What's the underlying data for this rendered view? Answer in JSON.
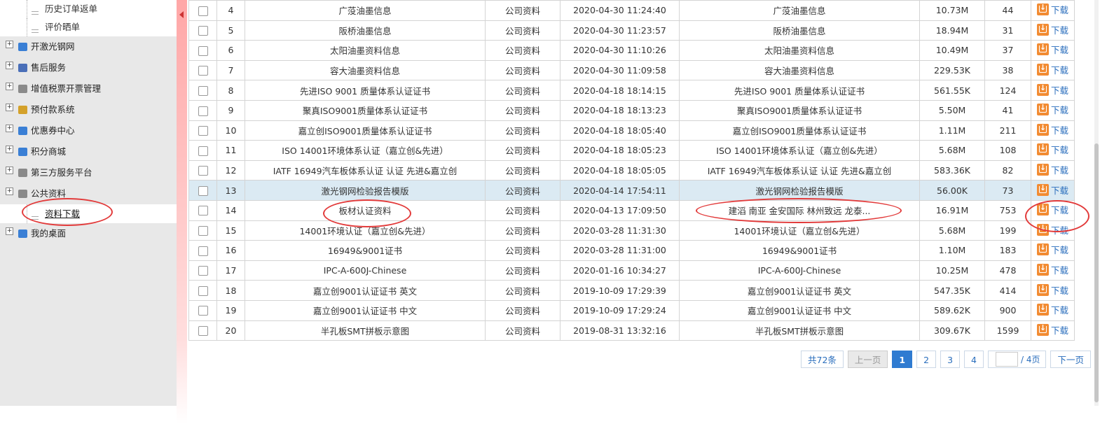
{
  "sidebar": {
    "sub_items_top": [
      {
        "label": "历史订单返单"
      },
      {
        "label": "评价晒单"
      }
    ],
    "items": [
      {
        "label": "开激光钢网",
        "icon": "stencil-icon",
        "color": "#3a7fd5"
      },
      {
        "label": "售后服务",
        "icon": "service-icon",
        "color": "#4a6fb8"
      },
      {
        "label": "增值税票开票管理",
        "icon": "invoice-icon",
        "color": "#8a8a8a"
      },
      {
        "label": "预付款系统",
        "icon": "wallet-icon",
        "color": "#d4a12a"
      },
      {
        "label": "优惠券中心",
        "icon": "coupon-icon",
        "color": "#3a7fd5"
      },
      {
        "label": "积分商城",
        "icon": "points-icon",
        "color": "#3a7fd5"
      },
      {
        "label": "第三方服务平台",
        "icon": "platform-icon",
        "color": "#8a8a8a"
      },
      {
        "label": "公共资料",
        "icon": "folder-icon",
        "color": "#8a8a8a"
      }
    ],
    "active_sub": {
      "label": "资料下载"
    },
    "last_item": {
      "label": "我的桌面",
      "icon": "desktop-icon",
      "color": "#3a7fd5"
    }
  },
  "table": {
    "rows": [
      {
        "no": "4",
        "name": "广莈油墨信息",
        "type": "公司资料",
        "time": "2020-04-30 11:24:40",
        "desc": "广莈油墨信息",
        "size": "10.73M",
        "downloads": "44"
      },
      {
        "no": "5",
        "name": "阪桥油墨信息",
        "type": "公司资料",
        "time": "2020-04-30 11:23:57",
        "desc": "阪桥油墨信息",
        "size": "18.94M",
        "downloads": "31"
      },
      {
        "no": "6",
        "name": "太阳油墨资料信息",
        "type": "公司资料",
        "time": "2020-04-30 11:10:26",
        "desc": "太阳油墨资料信息",
        "size": "10.49M",
        "downloads": "37"
      },
      {
        "no": "7",
        "name": "容大油墨资料信息",
        "type": "公司资料",
        "time": "2020-04-30 11:09:58",
        "desc": "容大油墨资料信息",
        "size": "229.53K",
        "downloads": "38"
      },
      {
        "no": "8",
        "name": "先进ISO 9001 质量体系认证证书",
        "type": "公司资料",
        "time": "2020-04-18 18:14:15",
        "desc": "先进ISO 9001 质量体系认证证书",
        "size": "561.55K",
        "downloads": "124"
      },
      {
        "no": "9",
        "name": "聚真ISO9001质量体系认证证书",
        "type": "公司资料",
        "time": "2020-04-18 18:13:23",
        "desc": "聚真ISO9001质量体系认证证书",
        "size": "5.50M",
        "downloads": "41"
      },
      {
        "no": "10",
        "name": "嘉立创ISO9001质量体系认证证书",
        "type": "公司资料",
        "time": "2020-04-18 18:05:40",
        "desc": "嘉立创ISO9001质量体系认证证书",
        "size": "1.11M",
        "downloads": "211"
      },
      {
        "no": "11",
        "name": "ISO 14001环境体系认证（嘉立创&先进）",
        "type": "公司资料",
        "time": "2020-04-18 18:05:23",
        "desc": "ISO 14001环境体系认证（嘉立创&先进）",
        "size": "5.68M",
        "downloads": "108"
      },
      {
        "no": "12",
        "name": "IATF 16949汽车板体系认证 认证 先进&嘉立创",
        "type": "公司资料",
        "time": "2020-04-18 18:05:05",
        "desc": "IATF 16949汽车板体系认证 认证 先进&嘉立创",
        "size": "583.36K",
        "downloads": "82"
      },
      {
        "no": "13",
        "name": "激光钢网检验报告模版",
        "type": "公司资料",
        "time": "2020-04-14 17:54:11",
        "desc": "激光钢网检验报告模版",
        "size": "56.00K",
        "downloads": "73"
      },
      {
        "no": "14",
        "name": "板材认证资料",
        "type": "公司资料",
        "time": "2020-04-13 17:09:50",
        "desc": "建滔 南亚 金安国际 林州致远 龙泰...",
        "size": "16.91M",
        "downloads": "753"
      },
      {
        "no": "15",
        "name": "14001环境认证（嘉立创&先进）",
        "type": "公司资料",
        "time": "2020-03-28 11:31:30",
        "desc": "14001环境认证（嘉立创&先进）",
        "size": "5.68M",
        "downloads": "199"
      },
      {
        "no": "16",
        "name": "16949&9001证书",
        "type": "公司资料",
        "time": "2020-03-28 11:31:00",
        "desc": "16949&9001证书",
        "size": "1.10M",
        "downloads": "183"
      },
      {
        "no": "17",
        "name": "IPC-A-600J-Chinese",
        "type": "公司资料",
        "time": "2020-01-16 10:34:27",
        "desc": "IPC-A-600J-Chinese",
        "size": "10.25M",
        "downloads": "478"
      },
      {
        "no": "18",
        "name": "嘉立创9001认证证书 英文",
        "type": "公司资料",
        "time": "2019-10-09 17:29:39",
        "desc": "嘉立创9001认证证书 英文",
        "size": "547.35K",
        "downloads": "414"
      },
      {
        "no": "19",
        "name": "嘉立创9001认证证书 中文",
        "type": "公司资料",
        "time": "2019-10-09 17:29:24",
        "desc": "嘉立创9001认证证书 中文",
        "size": "589.62K",
        "downloads": "900"
      },
      {
        "no": "20",
        "name": "半孔板SMT拼板示意图",
        "type": "公司资料",
        "time": "2019-08-31 13:32:16",
        "desc": "半孔板SMT拼板示意图",
        "size": "309.67K",
        "downloads": "1599"
      }
    ],
    "download_label": "下载",
    "highlight_row_no": "13"
  },
  "pager": {
    "total": "共72条",
    "prev": "上一页",
    "pages": [
      "1",
      "2",
      "3",
      "4"
    ],
    "current": "1",
    "of_pages": "/ 4页",
    "next": "下一页"
  }
}
